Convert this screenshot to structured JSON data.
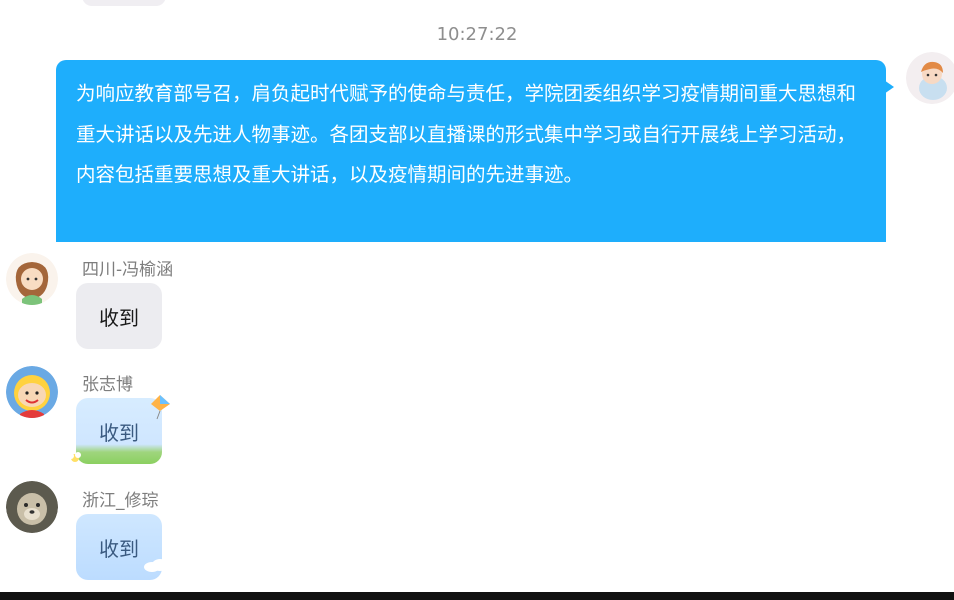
{
  "chat": {
    "timestamp": "10:27:22",
    "self_message": {
      "text": "为响应教育部号召，肩负起时代赋予的使命与责任，学院团委组织学习疫情期间重大思想和重大讲话以及先进人物事迹。各团支部以直播课的形式集中学习或自行开展线上学习活动，内容包括重要思想及重大讲话，以及疫情期间的先进事迹。"
    },
    "messages": [
      {
        "sender": "四川-冯榆涵",
        "text": "收到"
      },
      {
        "sender": "张志博",
        "text": "收到"
      },
      {
        "sender": "浙江_修琮",
        "text": "收到"
      }
    ]
  },
  "colors": {
    "self_bubble": "#1eaefc",
    "plain_bubble": "#ececf0",
    "theme_bubble": "#cfe6ff",
    "timestamp": "#8e8e8e",
    "sender_name": "#7d7d7d"
  },
  "icons": [
    "user-avatar-icon",
    "kite-sticker-icon",
    "cloud-sticker-icon"
  ]
}
